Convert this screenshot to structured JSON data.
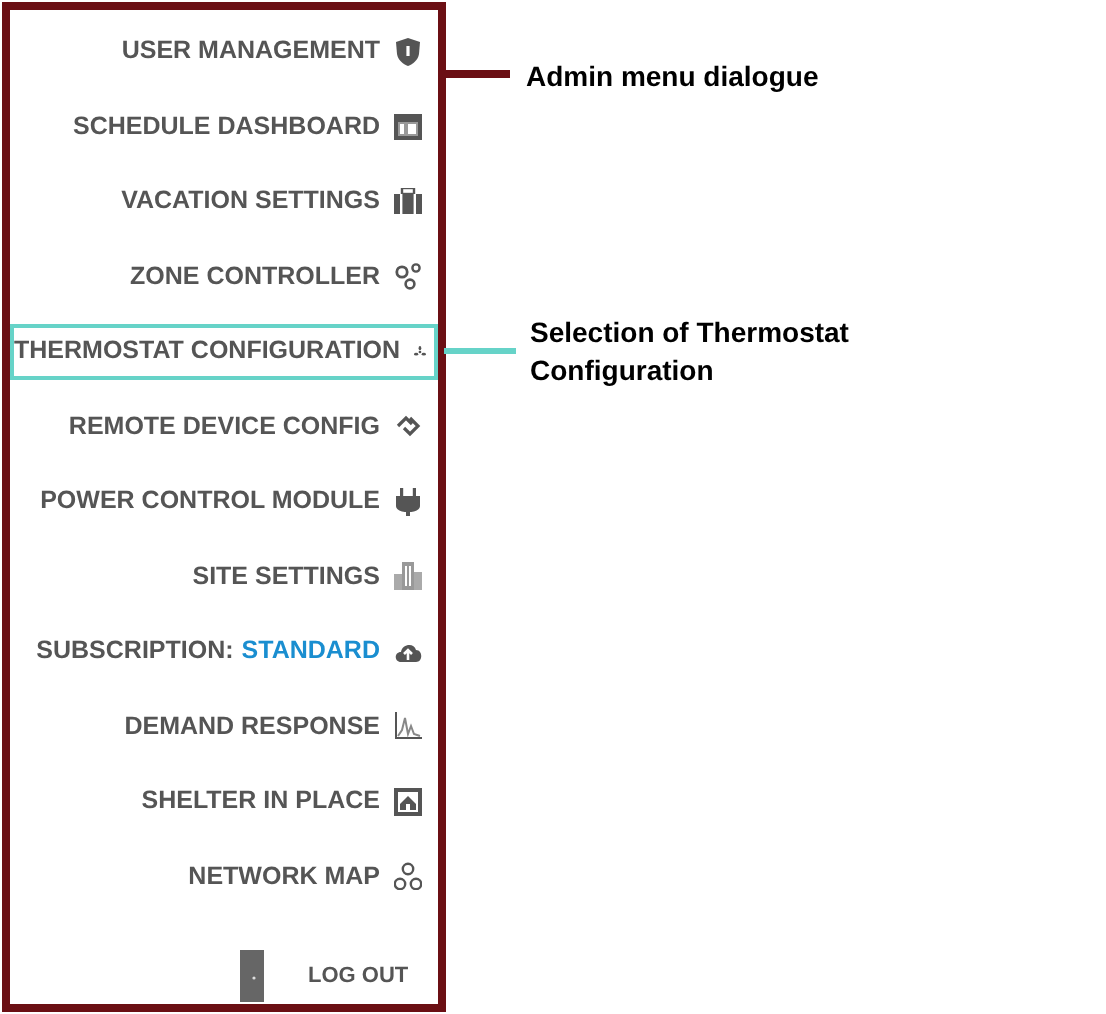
{
  "menu": {
    "items": [
      {
        "label": "USER MANAGEMENT",
        "selected": false
      },
      {
        "label": "SCHEDULE DASHBOARD",
        "selected": false
      },
      {
        "label": "VACATION SETTINGS",
        "selected": false
      },
      {
        "label": "ZONE CONTROLLER",
        "selected": false
      },
      {
        "label": "THERMOSTAT CONFIGURATION",
        "selected": true
      },
      {
        "label": "REMOTE DEVICE CONFIG",
        "selected": false
      },
      {
        "label": "POWER CONTROL MODULE",
        "selected": false
      },
      {
        "label": "SITE SETTINGS",
        "selected": false
      },
      {
        "label": "SUBSCRIPTION:",
        "value": "STANDARD",
        "selected": false
      },
      {
        "label": "DEMAND RESPONSE",
        "selected": false
      },
      {
        "label": "SHELTER IN PLACE",
        "selected": false
      },
      {
        "label": "NETWORK MAP",
        "selected": false
      }
    ],
    "logout": "LOG OUT"
  },
  "annotations": [
    {
      "text": "Admin menu dialogue",
      "color": "#6b0f14"
    },
    {
      "text": "Selection of Thermostat Configuration",
      "color": "#66d3c8"
    }
  ]
}
